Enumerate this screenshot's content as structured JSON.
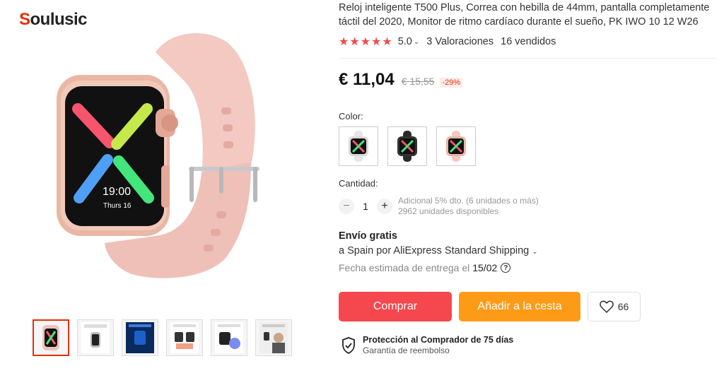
{
  "brand": {
    "logo_first": "S",
    "logo_rest": "oulusic"
  },
  "product": {
    "title": "Reloj inteligente T500 Plus, Correa con hebilla de 44mm, pantalla completamente táctil del 2020, Monitor de ritmo cardíaco durante el sueño, PK IWO 10 12 W26",
    "rating": 5.0,
    "rating_label": "5.0",
    "reviews": "3 Valoraciones",
    "sold": "16 vendidos",
    "watch_time": "19:00",
    "watch_date": "Thurs 16"
  },
  "price": {
    "current": "€ 11,04",
    "original": "€ 15,55",
    "discount": "-29%"
  },
  "color": {
    "label": "Color:",
    "options": [
      "silver",
      "black",
      "pink"
    ]
  },
  "quantity": {
    "label": "Cantidad:",
    "minus": "−",
    "value": "1",
    "plus": "+",
    "info_line1": "Adicional 5% dto. (6 unidades o más)",
    "info_line2": "2962 unidades disponibles"
  },
  "shipping": {
    "title": "Envío gratis",
    "line": "a Spain por AliExpress Standard Shipping",
    "delivery_label": "Fecha estimada de entrega el",
    "delivery_date": "15/02"
  },
  "actions": {
    "buy": "Comprar",
    "cart": "Añadir a la cesta",
    "wishlist_count": "66"
  },
  "protection": {
    "title": "Protección al Comprador de 75 días",
    "subtitle": "Garantía de reembolso"
  },
  "colors": {
    "accent_red": "#f5474e",
    "accent_orange": "#fd9b17",
    "star": "#f04a4a",
    "brand_red": "#e62e04",
    "band_pink": "#f3c9c2"
  },
  "icons": [
    "star-icon",
    "chevron-down-icon",
    "help-icon",
    "heart-icon",
    "shield-check-icon"
  ]
}
